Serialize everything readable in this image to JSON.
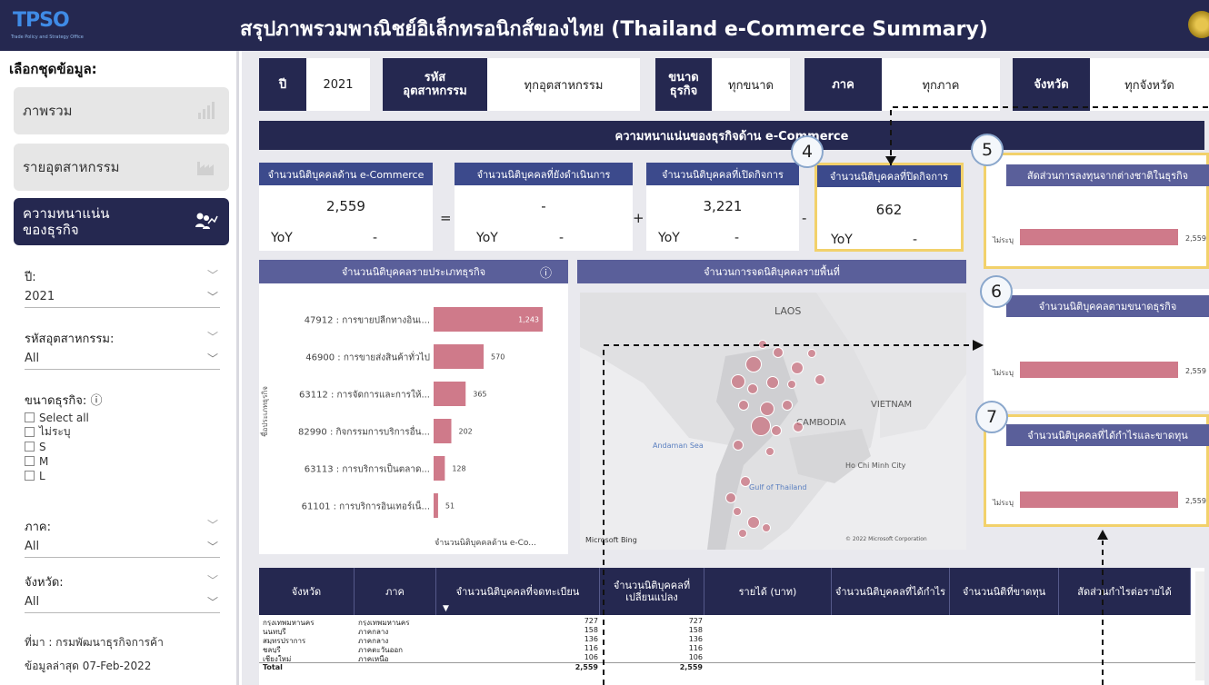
{
  "header": {
    "logo": "TPSO",
    "logo_sub": "Trade Policy and Strategy Office",
    "title": "สรุปภาพรวมพาณิชย์อิเล็กทรอนิกส์ของไทย (Thailand e-Commerce Summary)"
  },
  "sidebar": {
    "heading": "เลือกชุดข้อมูล:",
    "nav": [
      {
        "label": "ภาพรวม",
        "icon": "bar-chart-icon"
      },
      {
        "label": "รายอุตสาหกรรม",
        "icon": "factory-icon"
      },
      {
        "label": "ความหนาแน่น\nของธุรกิจ",
        "icon": "people-growth-icon"
      }
    ],
    "year_label": "ปี:",
    "year_value": "2021",
    "industry_label": "รหัสอุตสาหกรรม:",
    "industry_value": "All",
    "size_label": "ขนาดธุรกิจ:",
    "size_options": [
      "Select all",
      "ไม่ระบุ",
      "S",
      "M",
      "L"
    ],
    "region_label": "ภาค:",
    "region_value": "All",
    "province_label": "จังหวัด:",
    "province_value": "All",
    "source": "ที่มา : กรมพัฒนาธุรกิจการค้า",
    "updated": "ข้อมูลล่าสุด 07-Feb-2022"
  },
  "filters": [
    {
      "label": "ปี",
      "value": "2021"
    },
    {
      "label": "รหัส\nอุตสาหกรรม",
      "value": "ทุกอุตสาหกรรม"
    },
    {
      "label": "ขนาด\nธุรกิจ",
      "value": "ทุกขนาด"
    },
    {
      "label": "ภาค",
      "value": "ทุกภาค"
    },
    {
      "label": "จังหวัด",
      "value": "ทุกจังหวัด"
    }
  ],
  "banner": "ความหนาแน่นของธุรกิจด้าน e-Commerce",
  "kpis": [
    {
      "title": "จำนวนนิติบุคคลด้าน e-Commerce",
      "value": "2,559",
      "yoy_label": "YoY",
      "yoy": "-"
    },
    {
      "title": "จำนวนนิติบุคคลที่ยังดำเนินการ",
      "value": "-",
      "yoy_label": "YoY",
      "yoy": "-"
    },
    {
      "title": "จำนวนนิติบุคคลที่เปิดกิจการ",
      "value": "3,221",
      "yoy_label": "YoY",
      "yoy": "-"
    },
    {
      "title": "จำนวนนิติบุคคลที่ปิดกิจการ",
      "value": "662",
      "yoy_label": "YoY",
      "yoy": "-"
    }
  ],
  "ops": [
    "=",
    "+",
    "-"
  ],
  "callouts": [
    "4",
    "5",
    "6",
    "7"
  ],
  "type_chart": {
    "title": "จำนวนนิติบุคคลรายประเภทธุรกิจ",
    "ylabel": "ชื่อประเภทธุรกิจ",
    "xlabel": "จำนวนนิติบุคคลด้าน e-Co..."
  },
  "map": {
    "title": "จำนวนการจดนิติบุคคลรายพื้นที่",
    "labels": [
      "LAOS",
      "VIETNAM",
      "CAMBODIA",
      "Gulf of Thailand",
      "Andaman Sea",
      "Ho Chi Minh City",
      "Microsoft Bing",
      "© 2022 Microsoft Corporation"
    ]
  },
  "side_panels": [
    {
      "title": "สัดส่วนการลงทุนจากต่างชาติในธุรกิจ",
      "bar_label": "ไม่ระบุ",
      "value": "2,559"
    },
    {
      "title": "จำนวนนิติบุคคลตามขนาดธุรกิจ",
      "bar_label": "ไม่ระบุ",
      "value": "2,559"
    },
    {
      "title": "จำนวนนิติบุคคลที่ได้กำไรและขาดทุน",
      "bar_label": "ไม่ระบุ",
      "value": "2,559"
    }
  ],
  "table": {
    "headers": [
      "จังหวัด",
      "ภาค",
      "จำนวนนิติบุคคลที่จดทะเบียน",
      "จำนวนนิติบุคคลที่เปลี่ยนแปลง",
      "รายได้ (บาท)",
      "จำนวนนิติบุคคลที่ได้กำไร",
      "จำนวนนิติที่ขาดทุน",
      "สัดส่วนกำไรต่อรายได้"
    ],
    "rows": [
      [
        "กรุงเทพมหานคร",
        "กรุงเทพมหานคร",
        "727",
        "727"
      ],
      [
        "นนทบุรี",
        "ภาคกลาง",
        "158",
        "158"
      ],
      [
        "สมุทรปราการ",
        "ภาคกลาง",
        "136",
        "136"
      ],
      [
        "ชลบุรี",
        "ภาคตะวันออก",
        "116",
        "116"
      ],
      [
        "เชียงใหม่",
        "ภาคเหนือ",
        "106",
        "106"
      ]
    ],
    "total": [
      "Total",
      "",
      "2,559",
      "2,559"
    ]
  },
  "chart_data": [
    {
      "type": "bar",
      "title": "จำนวนนิติบุคคลรายประเภทธุรกิจ",
      "categories": [
        "47912 : การขายปลีกทางอินเ...",
        "46900 : การขายส่งสินค้าทั่วไป",
        "63112 : การจัดการและการให้...",
        "82990 : กิจกรรมการบริการอื่น...",
        "63113 : การบริการเป็นตลาด...",
        "61101 : การบริการอินเทอร์เน็..."
      ],
      "values": [
        1243,
        570,
        365,
        202,
        128,
        51
      ],
      "value_labels": [
        "1,243",
        "570",
        "365",
        "202",
        "128",
        "51"
      ],
      "xlabel": "จำนวนนิติบุคคลด้าน e-Co...",
      "ylabel": "ชื่อประเภทธุรกิจ"
    }
  ]
}
